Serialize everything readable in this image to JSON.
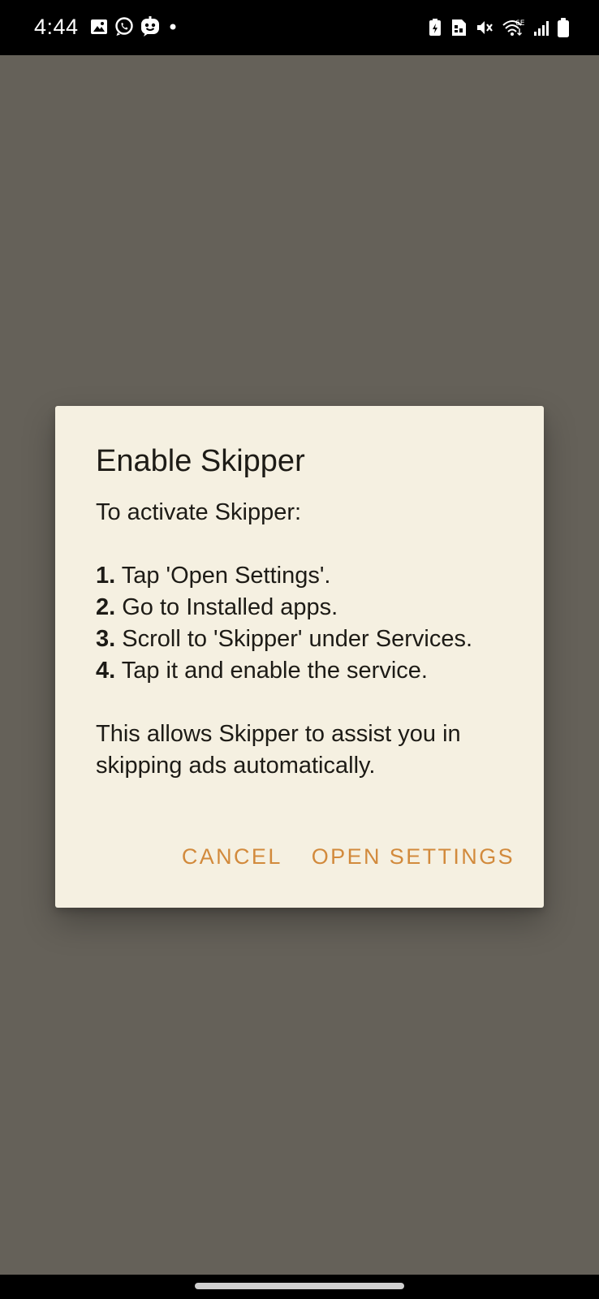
{
  "status_bar": {
    "time": "4:44",
    "left_icons": [
      "gallery-icon",
      "whatsapp-icon",
      "messenger-bot-icon",
      "notification-dot-icon"
    ],
    "right_icons": [
      "battery-saver-icon",
      "sim-icon",
      "mute-icon",
      "wifi-6e-icon",
      "signal-icon",
      "battery-icon"
    ],
    "wifi_label": "6E"
  },
  "dialog": {
    "title": "Enable Skipper",
    "intro": "To activate Skipper:",
    "steps": [
      {
        "num": "1.",
        "text": " Tap 'Open Settings'."
      },
      {
        "num": "2.",
        "text": " Go to Installed apps."
      },
      {
        "num": "3.",
        "text": " Scroll to 'Skipper' under Services."
      },
      {
        "num": "4.",
        "text": " Tap it and enable the service."
      }
    ],
    "outro": "This allows Skipper to assist you in skipping ads automatically.",
    "cancel_label": "CANCEL",
    "open_settings_label": "OPEN SETTINGS"
  },
  "colors": {
    "scrim": "#656159",
    "dialog_bg": "#f5f0e1",
    "accent": "#d28a3c",
    "text": "#1d1b16"
  }
}
